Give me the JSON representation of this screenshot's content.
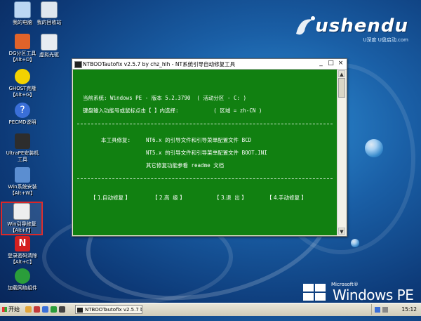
{
  "desktop": {
    "icons": [
      {
        "label": "我的电脑",
        "color": "#bcd7f3"
      },
      {
        "label": "我的回收站",
        "color": "#dfe7ef"
      },
      {
        "label": "DG分区工具\n【Alt+D】",
        "color": "#e0632a"
      },
      {
        "label": "虚拟光驱",
        "color": "#e7ecf2"
      },
      {
        "label": "GHOST克隆\n【Alt+G】",
        "color": "#f2d200"
      },
      {
        "label": "PECMD说明",
        "color": "#3a6fd8"
      },
      {
        "label": "UltraPE安装机\n工具",
        "color": "#2d2d2d"
      },
      {
        "label": "Win系统安装\n【Alt+W】",
        "color": "#5b8ed1"
      },
      {
        "label": "Win引导修复\n【Alt+F】",
        "color": "#eeeeee"
      },
      {
        "label": "登录密码清除\n【Alt+C】",
        "color": "#d42020"
      },
      {
        "label": "加载网络组件",
        "color": "#2a9d3a"
      }
    ]
  },
  "logo": {
    "text": "ushendu",
    "sub": "U深度 U盘启动.com"
  },
  "branding": {
    "microsoft": "Microsoft®",
    "windows_pe": "Windows PE"
  },
  "window": {
    "title": "NTBOOTautofix v2.5.7 by chz_hlh - NT系统引导自动修复工具",
    "lines": {
      "current_system": "当前系统: Windows PE - 版本 5.2.3790  ( 活动分区 - C: )",
      "input_prompt": "键盘输入功能号或鼠标点击【 】内选择:           ( 区域 = zh-CN )",
      "repair_label": "本工具修复: ",
      "nt6": "NT6.x 的引导文件和引导菜单配置文件 BCD",
      "nt5": "NT5.x 的引导文件和引导菜单配置文件 BOOT.INI",
      "other": "其它修复功能参看 readme 文档"
    },
    "menu": [
      "【 1.自动修复 】",
      "【 2.高  级 】",
      "【 3.退  出 】",
      "【 4.手动修复 】"
    ],
    "controls": {
      "minimize": "_",
      "maximize": "□",
      "close": "×"
    },
    "scroll_up": "▲",
    "scroll_down": "▼"
  },
  "taskbar": {
    "start_label": "开始",
    "task_label": "NTBOOTautofix v2.5.7 b...",
    "clock": "15:12"
  }
}
